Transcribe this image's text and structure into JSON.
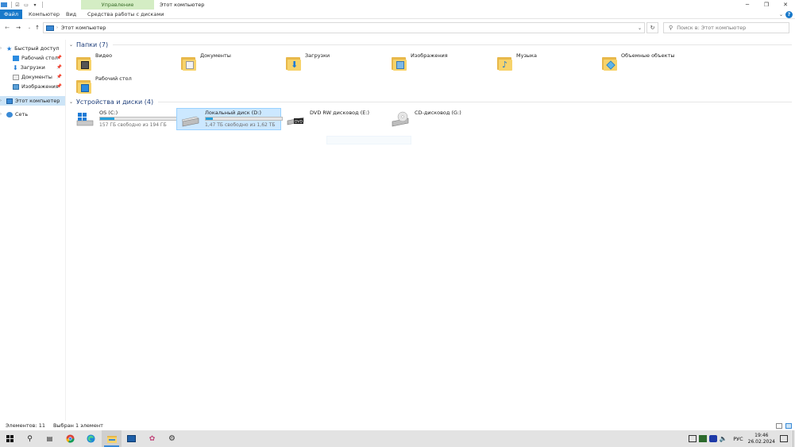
{
  "window": {
    "title": "Этот компьютер",
    "context_tab": "Управление"
  },
  "ribbon": {
    "tabs": [
      "Файл",
      "Компьютер",
      "Вид",
      "Средства работы с дисками"
    ]
  },
  "address": {
    "path": "Этот компьютер",
    "search_placeholder": "Поиск в: Этот компьютер"
  },
  "nav": {
    "quick_access": "Быстрый доступ",
    "pinned": [
      "Рабочий стол",
      "Загрузки",
      "Документы",
      "Изображения"
    ],
    "this_pc": "Этот компьютер",
    "network": "Сеть"
  },
  "folders": {
    "header": "Папки (7)",
    "items": [
      "Видео",
      "Документы",
      "Загрузки",
      "Изображения",
      "Музыка",
      "Объемные объекты",
      "Рабочий стол"
    ]
  },
  "devices": {
    "header": "Устройства и диски (4)",
    "items": [
      {
        "name": "OS (C:)",
        "free": "157 ГБ свободно из 194 ГБ",
        "used_fraction": 0.19
      },
      {
        "name": "Локальный диск (D:)",
        "free": "1,47 ТБ свободно из 1,62 ТБ",
        "used_fraction": 0.09
      },
      {
        "name": "DVD RW дисковод (E:)"
      },
      {
        "name": "CD-дисковод (G:)"
      }
    ]
  },
  "status": {
    "count": "Элементов: 11",
    "selected": "Выбран 1 элемент"
  },
  "taskbar": {
    "lang": "РУС",
    "time": "19:46",
    "date": "26.02.2024"
  },
  "colors": {
    "accent": "#1979ca",
    "selection": "#cce8ff",
    "drive_bar": "#26a0da",
    "folder": "#f7d36b"
  }
}
